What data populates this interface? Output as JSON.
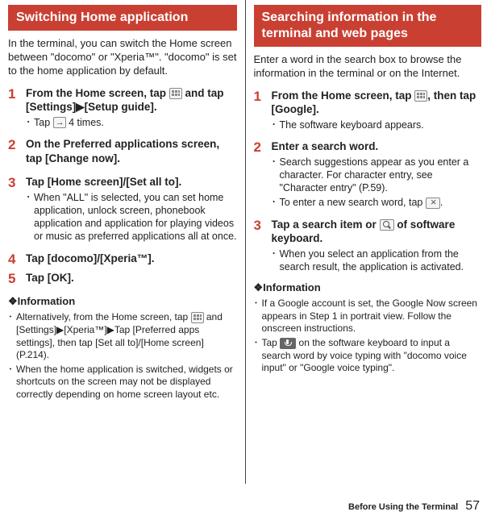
{
  "left": {
    "header": "Switching Home application",
    "intro": "In the terminal, you can switch the Home screen between \"docomo\" or \"Xperia™\". \"docomo\" is set to the home application by default.",
    "steps": [
      {
        "num": "1",
        "title_a": "From the Home screen, tap ",
        "title_b": " and tap [Settings]",
        "title_c": "[Setup guide].",
        "bullets": [
          {
            "pre": "Tap ",
            "post": " 4 times."
          }
        ]
      },
      {
        "num": "2",
        "title": "On the Preferred applications screen, tap [Change now].",
        "bullets": []
      },
      {
        "num": "3",
        "title": "Tap [Home screen]/[Set all to].",
        "bullets": [
          {
            "text": "When \"ALL\" is selected, you can set home application, unlock screen, phonebook application and application for playing videos or music as preferred applications all at once."
          }
        ]
      },
      {
        "num": "4",
        "title": "Tap [docomo]/[Xperia™].",
        "bullets": []
      },
      {
        "num": "5",
        "title": "Tap [OK].",
        "bullets": []
      }
    ],
    "info_header": "❖Information",
    "info": [
      {
        "pre": "Alternatively, from the Home screen, tap ",
        "mid": " and [Settings]",
        "mid2": "[Xperia™]",
        "mid3": "Tap [Preferred apps settings], then tap [Set all to]/[Home screen] (P.214)."
      },
      {
        "text": "When the home application is switched, widgets or shortcuts on the screen may not be displayed correctly depending on home screen layout etc."
      }
    ]
  },
  "right": {
    "header": "Searching information in the terminal and web pages",
    "intro": "Enter a word in the search box to browse the information in the terminal or on the Internet.",
    "steps": [
      {
        "num": "1",
        "title_a": "From the Home screen, tap ",
        "title_b": ", then tap [Google].",
        "bullets": [
          {
            "text": "The software keyboard appears."
          }
        ]
      },
      {
        "num": "2",
        "title": "Enter a search word.",
        "bullets": [
          {
            "text": "Search suggestions appear as you enter a character. For character entry, see \"Character entry\" (P.59)."
          },
          {
            "pre": "To enter a new search word, tap ",
            "post": "."
          }
        ]
      },
      {
        "num": "3",
        "title_a": "Tap a search item or ",
        "title_b": " of software keyboard.",
        "bullets": [
          {
            "text": "When you select an application from the search result, the application is activated."
          }
        ]
      }
    ],
    "info_header": "❖Information",
    "info": [
      {
        "text": "If a Google account is set, the Google Now screen appears in Step 1 in portrait view. Follow the onscreen instructions."
      },
      {
        "pre": "Tap ",
        "post": " on the software keyboard to input a search word by voice typing with \"docomo voice input\" or \"Google voice typing\"."
      }
    ]
  },
  "footer_label": "Before Using the Terminal",
  "page_number": "57"
}
